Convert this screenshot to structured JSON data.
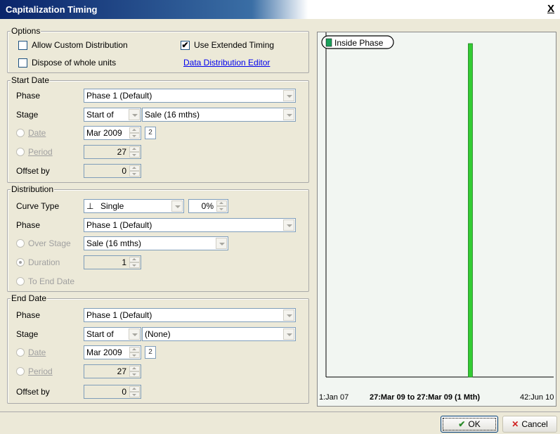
{
  "window": {
    "title": "Capitalization Timing",
    "close_label": "X"
  },
  "options": {
    "legend": "Options",
    "allow_custom": {
      "label": "Allow Custom Distribution",
      "checked": false
    },
    "use_extended": {
      "label": "Use Extended Timing",
      "checked": true
    },
    "dispose_whole": {
      "label": "Dispose of whole units",
      "checked": false
    },
    "data_link": "Data Distribution Editor"
  },
  "start_date": {
    "legend": "Start Date",
    "phase_label": "Phase",
    "phase_value": "Phase 1  (Default)",
    "stage_label": "Stage",
    "stage_mode": "Start of",
    "stage_value": "Sale (16 mths)",
    "date_label": "Date",
    "date_value": "Mar 2009",
    "cal_icon_text": "2",
    "period_label": "Period",
    "period_value": "27",
    "offset_label": "Offset by",
    "offset_value": "0"
  },
  "distribution": {
    "legend": "Distribution",
    "curve_label": "Curve Type",
    "curve_value": "Single",
    "curve_pct": "0%",
    "phase_label": "Phase",
    "phase_value": "Phase 1  (Default)",
    "over_stage_label": "Over Stage",
    "over_stage_value": "Sale (16 mths)",
    "duration_label": "Duration",
    "duration_value": "1",
    "to_end_label": "To End Date"
  },
  "end_date": {
    "legend": "End Date",
    "phase_label": "Phase",
    "phase_value": "Phase 1  (Default)",
    "stage_label": "Stage",
    "stage_mode": "Start of",
    "stage_value": "(None)",
    "date_label": "Date",
    "date_value": "Mar 2009",
    "cal_icon_text": "2",
    "period_label": "Period",
    "period_value": "27",
    "offset_label": "Offset by",
    "offset_value": "0"
  },
  "chart": {
    "legend_label": "Inside Phase",
    "x_start": "1:Jan 07",
    "x_mid": "27:Mar 09 to 27:Mar 09 (1 Mth)",
    "x_end": "42:Jun 10",
    "bar_color": "#33cc33"
  },
  "chart_data": {
    "type": "bar",
    "categories": [
      "27:Mar 09"
    ],
    "series": [
      {
        "name": "Inside Phase",
        "values": [
          1
        ]
      }
    ],
    "x_range": [
      1,
      42
    ],
    "bar_period": 27
  },
  "buttons": {
    "ok": "OK",
    "cancel": "Cancel"
  }
}
